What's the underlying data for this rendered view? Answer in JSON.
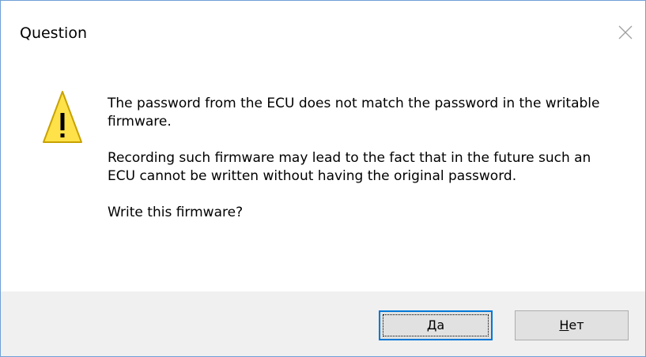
{
  "dialog": {
    "title": "Question",
    "close_icon": "close-icon",
    "warning_icon": "warning-icon",
    "message": {
      "line1": "The password from the ECU does not match the password in the writable firmware.",
      "line2": "Recording such firmware may lead to the fact that in the future such an ECU cannot be written without having the original password.",
      "line3": "Write this firmware?"
    },
    "buttons": {
      "yes_accel": "Д",
      "yes_rest": "а",
      "no_accel": "Н",
      "no_rest": "ет"
    }
  },
  "colors": {
    "accent": "#0078d7",
    "warning_fill": "#ffe14a",
    "footer_bg": "#f0f0f0"
  }
}
